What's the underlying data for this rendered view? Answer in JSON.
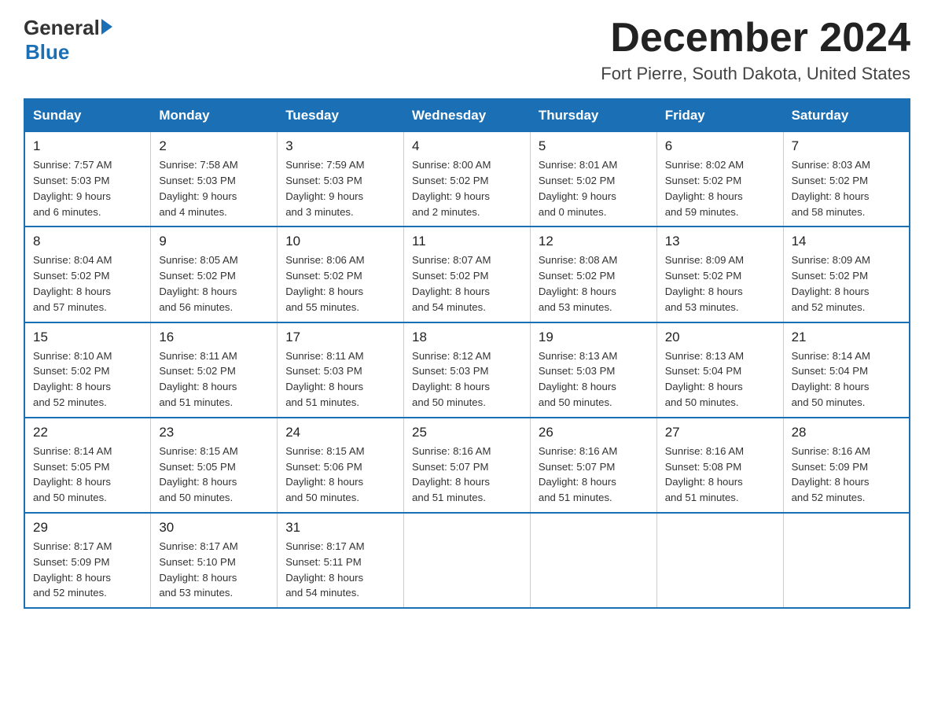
{
  "logo": {
    "general": "General",
    "blue": "Blue",
    "arrow": "▶"
  },
  "title": "December 2024",
  "subtitle": "Fort Pierre, South Dakota, United States",
  "weekdays": [
    "Sunday",
    "Monday",
    "Tuesday",
    "Wednesday",
    "Thursday",
    "Friday",
    "Saturday"
  ],
  "weeks": [
    [
      {
        "day": "1",
        "sunrise": "7:57 AM",
        "sunset": "5:03 PM",
        "daylight": "9 hours and 6 minutes."
      },
      {
        "day": "2",
        "sunrise": "7:58 AM",
        "sunset": "5:03 PM",
        "daylight": "9 hours and 4 minutes."
      },
      {
        "day": "3",
        "sunrise": "7:59 AM",
        "sunset": "5:03 PM",
        "daylight": "9 hours and 3 minutes."
      },
      {
        "day": "4",
        "sunrise": "8:00 AM",
        "sunset": "5:02 PM",
        "daylight": "9 hours and 2 minutes."
      },
      {
        "day": "5",
        "sunrise": "8:01 AM",
        "sunset": "5:02 PM",
        "daylight": "9 hours and 0 minutes."
      },
      {
        "day": "6",
        "sunrise": "8:02 AM",
        "sunset": "5:02 PM",
        "daylight": "8 hours and 59 minutes."
      },
      {
        "day": "7",
        "sunrise": "8:03 AM",
        "sunset": "5:02 PM",
        "daylight": "8 hours and 58 minutes."
      }
    ],
    [
      {
        "day": "8",
        "sunrise": "8:04 AM",
        "sunset": "5:02 PM",
        "daylight": "8 hours and 57 minutes."
      },
      {
        "day": "9",
        "sunrise": "8:05 AM",
        "sunset": "5:02 PM",
        "daylight": "8 hours and 56 minutes."
      },
      {
        "day": "10",
        "sunrise": "8:06 AM",
        "sunset": "5:02 PM",
        "daylight": "8 hours and 55 minutes."
      },
      {
        "day": "11",
        "sunrise": "8:07 AM",
        "sunset": "5:02 PM",
        "daylight": "8 hours and 54 minutes."
      },
      {
        "day": "12",
        "sunrise": "8:08 AM",
        "sunset": "5:02 PM",
        "daylight": "8 hours and 53 minutes."
      },
      {
        "day": "13",
        "sunrise": "8:09 AM",
        "sunset": "5:02 PM",
        "daylight": "8 hours and 53 minutes."
      },
      {
        "day": "14",
        "sunrise": "8:09 AM",
        "sunset": "5:02 PM",
        "daylight": "8 hours and 52 minutes."
      }
    ],
    [
      {
        "day": "15",
        "sunrise": "8:10 AM",
        "sunset": "5:02 PM",
        "daylight": "8 hours and 52 minutes."
      },
      {
        "day": "16",
        "sunrise": "8:11 AM",
        "sunset": "5:02 PM",
        "daylight": "8 hours and 51 minutes."
      },
      {
        "day": "17",
        "sunrise": "8:11 AM",
        "sunset": "5:03 PM",
        "daylight": "8 hours and 51 minutes."
      },
      {
        "day": "18",
        "sunrise": "8:12 AM",
        "sunset": "5:03 PM",
        "daylight": "8 hours and 50 minutes."
      },
      {
        "day": "19",
        "sunrise": "8:13 AM",
        "sunset": "5:03 PM",
        "daylight": "8 hours and 50 minutes."
      },
      {
        "day": "20",
        "sunrise": "8:13 AM",
        "sunset": "5:04 PM",
        "daylight": "8 hours and 50 minutes."
      },
      {
        "day": "21",
        "sunrise": "8:14 AM",
        "sunset": "5:04 PM",
        "daylight": "8 hours and 50 minutes."
      }
    ],
    [
      {
        "day": "22",
        "sunrise": "8:14 AM",
        "sunset": "5:05 PM",
        "daylight": "8 hours and 50 minutes."
      },
      {
        "day": "23",
        "sunrise": "8:15 AM",
        "sunset": "5:05 PM",
        "daylight": "8 hours and 50 minutes."
      },
      {
        "day": "24",
        "sunrise": "8:15 AM",
        "sunset": "5:06 PM",
        "daylight": "8 hours and 50 minutes."
      },
      {
        "day": "25",
        "sunrise": "8:16 AM",
        "sunset": "5:07 PM",
        "daylight": "8 hours and 51 minutes."
      },
      {
        "day": "26",
        "sunrise": "8:16 AM",
        "sunset": "5:07 PM",
        "daylight": "8 hours and 51 minutes."
      },
      {
        "day": "27",
        "sunrise": "8:16 AM",
        "sunset": "5:08 PM",
        "daylight": "8 hours and 51 minutes."
      },
      {
        "day": "28",
        "sunrise": "8:16 AM",
        "sunset": "5:09 PM",
        "daylight": "8 hours and 52 minutes."
      }
    ],
    [
      {
        "day": "29",
        "sunrise": "8:17 AM",
        "sunset": "5:09 PM",
        "daylight": "8 hours and 52 minutes."
      },
      {
        "day": "30",
        "sunrise": "8:17 AM",
        "sunset": "5:10 PM",
        "daylight": "8 hours and 53 minutes."
      },
      {
        "day": "31",
        "sunrise": "8:17 AM",
        "sunset": "5:11 PM",
        "daylight": "8 hours and 54 minutes."
      },
      null,
      null,
      null,
      null
    ]
  ],
  "labels": {
    "sunrise": "Sunrise:",
    "sunset": "Sunset:",
    "daylight": "Daylight:"
  }
}
